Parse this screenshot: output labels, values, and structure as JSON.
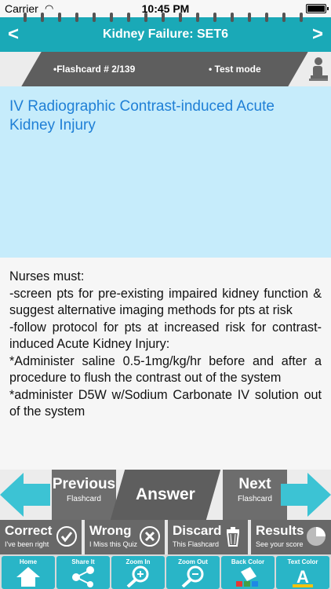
{
  "status": {
    "carrier": "Carrier",
    "time": "10:45 PM"
  },
  "nav": {
    "title": "Kidney Failure: SET6",
    "prev": "<",
    "next": ">"
  },
  "sub": {
    "flashcard": "•Flashcard #  2/139",
    "mode": "• Test mode"
  },
  "card": {
    "question": "IV Radiographic Contrast-induced Acute Kidney Injury",
    "answer": "Nurses must:\n-screen pts for pre-existing impaired kidney function & suggest alternative imaging methods for pts at risk\n-follow protocol for pts at increased risk for contrast-induced Acute Kidney Injury:\n  *Administer saline 0.5-1mg/kg/hr before and after a procedure to flush the contrast out of the system\n  *administer D5W w/Sodium Carbonate IV solution out of the system"
  },
  "controls": {
    "previous": {
      "label": "Previous",
      "sub": "Flashcard"
    },
    "answer": "Answer",
    "next": {
      "label": "Next",
      "sub": "Flashcard"
    }
  },
  "actions": [
    {
      "label": "Correct",
      "sub": "I've been right",
      "icon": "check-icon"
    },
    {
      "label": "Wrong",
      "sub": "I Miss this Quiz",
      "icon": "x-icon"
    },
    {
      "label": "Discard",
      "sub": "This Flashcard",
      "icon": "trash-icon"
    },
    {
      "label": "Results",
      "sub": "See your score",
      "icon": "pie-icon"
    }
  ],
  "tools": [
    {
      "label": "Home",
      "icon": "home-icon"
    },
    {
      "label": "Share It",
      "icon": "share-icon"
    },
    {
      "label": "Zoom In",
      "icon": "zoom-in-icon"
    },
    {
      "label": "Zoom Out",
      "icon": "zoom-out-icon"
    },
    {
      "label": "Back Color",
      "icon": "paint-bucket-icon"
    },
    {
      "label": "Text Color",
      "icon": "text-color-icon"
    }
  ],
  "colors": {
    "teal": "#1aa9b7",
    "question_bg": "#c6ecfb",
    "question_text": "#1f7fd6",
    "dark": "#5e5e5e"
  }
}
